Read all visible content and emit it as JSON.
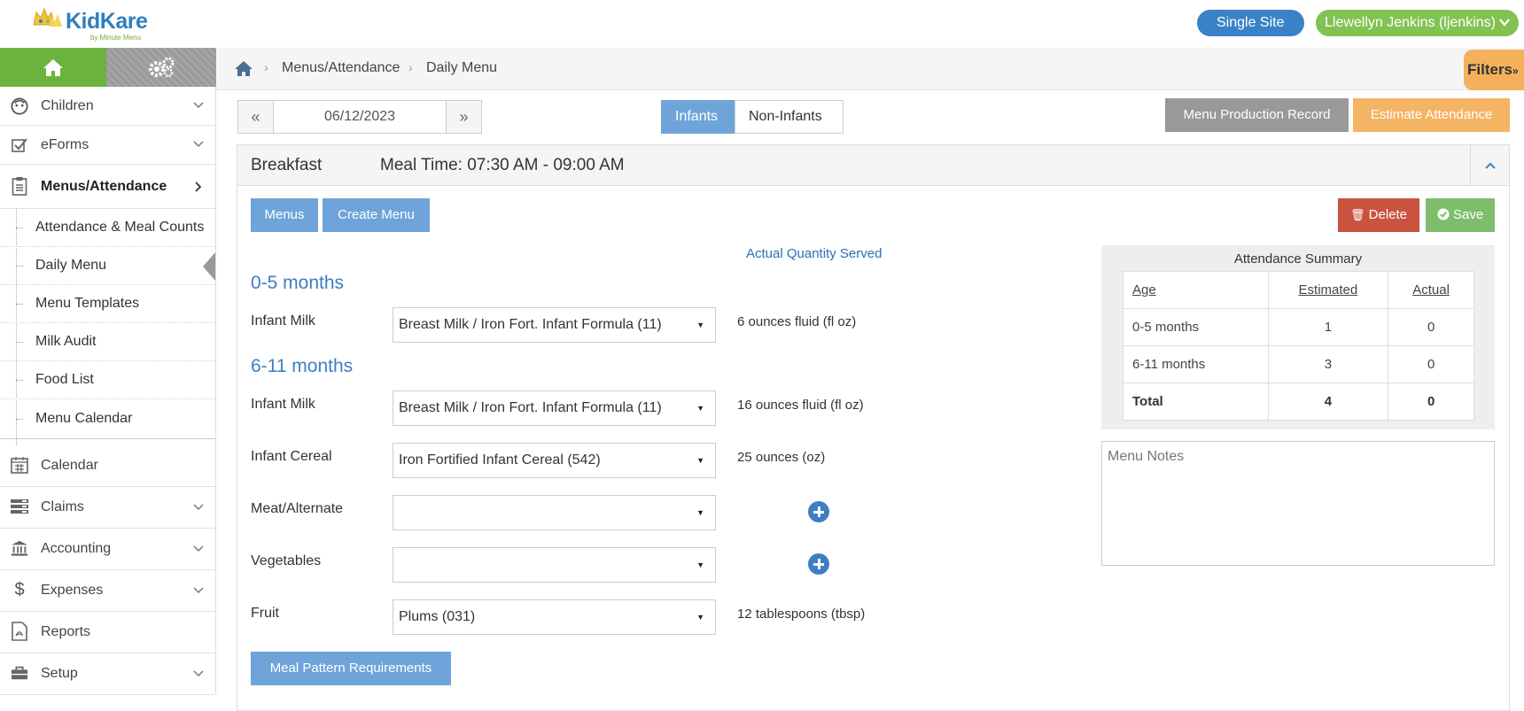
{
  "topbar": {
    "logo_text": "KidKare",
    "logo_sub": "by Minute Menu",
    "site_label": "Single Site",
    "user_label": "Llewellyn Jenkins (ljenkins)"
  },
  "sidebar": {
    "items": [
      {
        "label": "Children",
        "icon": "face-icon"
      },
      {
        "label": "eForms",
        "icon": "checkbox-icon"
      },
      {
        "label": "Menus/Attendance",
        "icon": "clipboard-icon"
      },
      {
        "label": "Calendar",
        "icon": "calendar-icon"
      },
      {
        "label": "Claims",
        "icon": "claims-icon"
      },
      {
        "label": "Accounting",
        "icon": "bank-icon"
      },
      {
        "label": "Expenses",
        "icon": "dollar-icon"
      },
      {
        "label": "Reports",
        "icon": "pdf-icon"
      },
      {
        "label": "Setup",
        "icon": "briefcase-icon"
      }
    ],
    "subitems": [
      {
        "label": "Attendance & Meal Counts"
      },
      {
        "label": "Daily Menu"
      },
      {
        "label": "Menu Templates"
      },
      {
        "label": "Milk Audit"
      },
      {
        "label": "Food List"
      },
      {
        "label": "Menu Calendar"
      }
    ]
  },
  "breadcrumb": {
    "parent": "Menus/Attendance",
    "current": "Daily Menu",
    "filters": "Filters"
  },
  "datenav": {
    "prev": "«",
    "date": "06/12/2023",
    "next": "»"
  },
  "segment": {
    "infants": "Infants",
    "non_infants": "Non-Infants"
  },
  "actions": {
    "menu_production_record": "Menu Production Record",
    "estimate_attendance": "Estimate Attendance"
  },
  "meal": {
    "name": "Breakfast",
    "time": "Meal Time: 07:30 AM - 09:00 AM",
    "menus_btn": "Menus",
    "create_btn": "Create Menu",
    "delete_btn": "Delete",
    "save_btn": "Save",
    "quantity_header": "Actual Quantity Served",
    "meal_pattern_btn": "Meal Pattern Requirements"
  },
  "groups": [
    {
      "age": "0-5 months",
      "rows": [
        {
          "label": "Infant Milk",
          "value": "Breast Milk / Iron Fort. Infant Formula (11)",
          "qty": "6 ounces fluid (fl oz)"
        }
      ]
    },
    {
      "age": "6-11 months",
      "rows": [
        {
          "label": "Infant Milk",
          "value": "Breast Milk / Iron Fort. Infant Formula (11)",
          "qty": "16 ounces fluid (fl oz)"
        },
        {
          "label": "Infant Cereal",
          "value": "Iron Fortified Infant Cereal (542)",
          "qty": "25 ounces (oz)"
        },
        {
          "label": "Meat/Alternate",
          "value": "",
          "qty": ""
        },
        {
          "label": "Vegetables",
          "value": "",
          "qty": ""
        },
        {
          "label": "Fruit",
          "value": "Plums (031)",
          "qty": "12 tablespoons (tbsp)"
        }
      ]
    }
  ],
  "attendance": {
    "title": "Attendance Summary",
    "headers": [
      "Age",
      "Estimated",
      "Actual"
    ],
    "rows": [
      [
        "0-5 months",
        "1",
        "0"
      ],
      [
        "6-11 months",
        "3",
        "0"
      ],
      [
        "Total",
        "4",
        "0"
      ]
    ]
  },
  "notes": {
    "placeholder": "Menu Notes"
  },
  "colors": {
    "green": "#6bb33e",
    "blue": "#6ea4d9",
    "orange": "#f4b464",
    "red": "#c9533f",
    "link": "#3e7ec2"
  }
}
